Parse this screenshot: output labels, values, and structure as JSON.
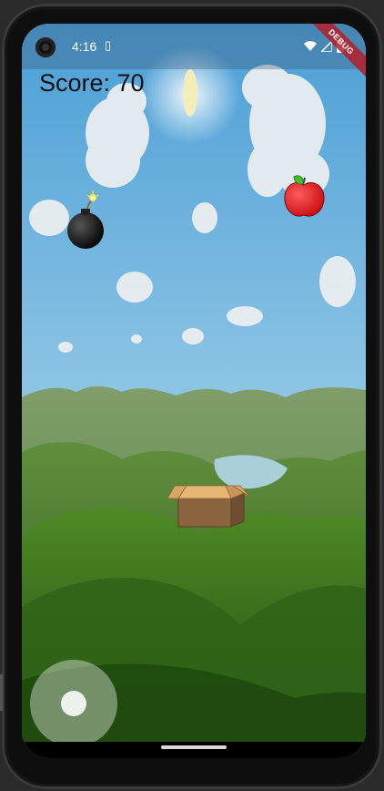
{
  "status_bar": {
    "time": "4:16",
    "sim_icon": "sim-card-icon",
    "icons": [
      "wifi-icon",
      "cell-signal-icon",
      "battery-icon"
    ]
  },
  "debug_banner": "DEBUG",
  "hud": {
    "score_label": "Score: 70"
  },
  "game_objects": [
    {
      "name": "bomb",
      "icon": "bomb-icon"
    },
    {
      "name": "apple",
      "icon": "apple-icon"
    },
    {
      "name": "basket",
      "icon": "cardboard-box-icon"
    }
  ],
  "controls": {
    "joystick": "virtual-joystick"
  },
  "colors": {
    "sky_top": "#4a9fd6",
    "sky_bottom": "#c9e3f1",
    "hills": "#3f7a2a",
    "apple": "#e3151d",
    "box": "#8b6540"
  }
}
